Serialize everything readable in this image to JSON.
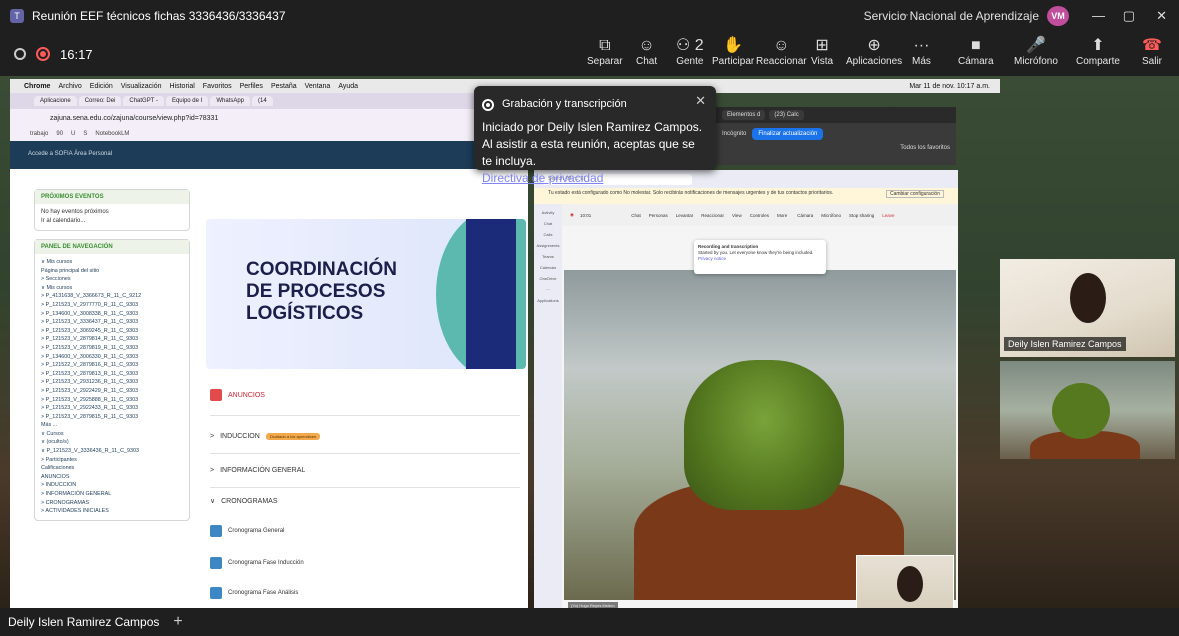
{
  "window": {
    "title": "Reunión EEF técnicos fichas 3336436/3336437",
    "org": "Servicio Nacional de Aprendizaje",
    "avatar": "VM",
    "more": "···",
    "min": "—",
    "max": "▢",
    "close": "✕"
  },
  "meeting": {
    "time": "16:17"
  },
  "toolbar": [
    {
      "id": "separar",
      "label": "Separar",
      "icon": "⧉"
    },
    {
      "id": "chat",
      "label": "Chat",
      "icon": "☺"
    },
    {
      "id": "gente",
      "label": "Gente",
      "icon": "⚇ 2"
    },
    {
      "id": "participar",
      "label": "Participar",
      "icon": "✋"
    },
    {
      "id": "reaccionar",
      "label": "Reaccionar",
      "icon": "☺"
    },
    {
      "id": "vista",
      "label": "Vista",
      "icon": "⊞"
    },
    {
      "id": "aplicaciones",
      "label": "Aplicaciones",
      "icon": "⊕"
    },
    {
      "id": "mas",
      "label": "Más",
      "icon": "···"
    },
    {
      "id": "camara",
      "label": "Cámara",
      "icon": "■"
    },
    {
      "id": "microfono",
      "label": "Micrófono",
      "icon": "🎤"
    },
    {
      "id": "comparte",
      "label": "Comparte",
      "icon": "⬆"
    },
    {
      "id": "salir",
      "label": "Salir",
      "icon": "☎"
    }
  ],
  "macbar": {
    "items": [
      "Chrome",
      "Archivo",
      "Edición",
      "Visualización",
      "Historial",
      "Favoritos",
      "Perfiles",
      "Pestaña",
      "Ventana",
      "Ayuda"
    ],
    "datetime": "Mar 11 de nov. 10:17 a.m."
  },
  "chrome": {
    "tabs": [
      "Aplicacione",
      "Correo: Dei",
      "ChatGPT -",
      "Equipo de I",
      "WhatsApp",
      "(14"
    ],
    "url": "zajuna.sena.edu.co/zajuna/course/view.php?id=78331",
    "bookmarks": [
      "trabajo",
      "90",
      "U",
      "S",
      "NotebookLM"
    ],
    "sofia": "Accede a SOFIA   Área Personal"
  },
  "moodle": {
    "events_title": "PRÓXIMOS EVENTOS",
    "events_none": "No hay eventos próximos",
    "events_link": "Ir al calendario...",
    "nav_title": "PANEL DE NAVEGACIÓN",
    "nav": [
      "∨ Mis cursos",
      "Página principal del sitio",
      "> Secciones",
      "∨ Mis cursos",
      "> P_4131638_V_3366673_R_11_C_9212",
      "> P_121523_V_2977770_R_11_C_9303",
      "> P_134600_V_3008338_R_11_C_9303",
      "> P_121523_V_3336437_R_11_C_9303",
      "> P_121523_V_3069245_R_11_C_9303",
      "> P_121523_V_2879814_R_11_C_9303",
      "> P_121523_V_2879819_R_11_C_9303",
      "> P_134600_V_3006330_R_11_C_9303",
      "> P_121522_V_2879816_R_11_C_9303",
      "> P_121523_V_2879813_R_11_C_9303",
      "> P_121523_V_2931236_R_11_C_9303",
      "> P_121523_V_2922429_R_11_C_9303",
      "> P_121523_V_2925888_R_11_C_9303",
      "> P_121523_V_2922433_R_11_C_9303",
      "> P_121523_V_2879815_R_11_C_9303",
      "Más ...",
      "∨ Cursos",
      "∨ (oculto/s)",
      "∨ P_121523_V_3336436_R_11_C_9303",
      "> Participantes",
      "Calificaciones",
      "ANUNCIOS",
      "> INDUCCION",
      "> INFORMACIÓN GENERAL",
      "> CRONOGRAMAS",
      "> ACTIVIDADES INICIALES"
    ],
    "course_title_1": "COORDINACIÓN",
    "course_title_2": "DE PROCESOS",
    "course_title_3": "LOGÍSTICOS",
    "anuncios": "ANUNCIOS",
    "induccion": "INDUCCION",
    "badge": "Ocultado a los aprendices",
    "info": "INFORMACIÓN GENERAL",
    "crono": "CRONOGRAMAS",
    "files": [
      "Cronograma General",
      "Cronograma Fase Inducción",
      "Cronograma Fase Análisis"
    ]
  },
  "popup": {
    "title": "Grabación y transcripción",
    "body": "Iniciado por Deily Islen Ramirez Campos. Al asistir a esta reunión, aceptas que se te incluya.",
    "link": "Directiva de privacidad"
  },
  "chrome2": {
    "tabs": [
      "Elementos d",
      "(23) Calc"
    ],
    "incognito": "Incógnito",
    "update": "Finalizar actualización",
    "favorites": "Todos los favoritos"
  },
  "inner": {
    "search": "Search (⌘ ⌥ E)",
    "notice": "Tu estado está configurado como No molestar. Solo recibirás notificaciones de mensajes urgentes y de tus contactos prioritarios.",
    "notice_btn": "Cambiar configuración",
    "time": "10:01",
    "rail": [
      "Activity",
      "Chat",
      "Calls",
      "Assignments",
      "Teams",
      "Calendar",
      "OneDrive",
      "···",
      "Applications"
    ],
    "bar": [
      "Chat",
      "Personas",
      "Levantar",
      "Reaccionar",
      "View",
      "Controles",
      "More",
      "Cámara",
      "Micrófono",
      "Stop sharing",
      "Leave"
    ],
    "pop_title": "Recording and transcription",
    "pop_body": "Started by you. Let everyone know they're being included.",
    "pop_link": "Privacy notice",
    "name": "(Yo) Hugo Reyes Melero"
  },
  "participant1": "Deily Islen Ramirez Campos",
  "bottom": {
    "tab": "Deily Islen Ramirez Campos",
    "add": "+"
  }
}
